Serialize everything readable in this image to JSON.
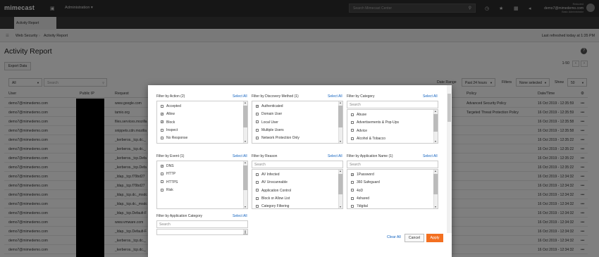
{
  "topbar": {
    "logo": "mimecast",
    "menu": "Administration ▾",
    "search_placeholder": "Search Mimecast Center",
    "user_label": "Reducted",
    "user_email": "demo7@mimedemo.com",
    "user_role": "Basic Administrator"
  },
  "tab": {
    "label": "Activity Report"
  },
  "breadcrumb": {
    "items": [
      "Web Security",
      "Activity Report"
    ],
    "refresh": "Last refreshed today at 1:35 PM"
  },
  "page": {
    "title": "Activity Report",
    "pagination": "1-50"
  },
  "toolbar": {
    "export": "Export Data",
    "scope": "All",
    "search_placeholder": "Search",
    "date_range_label": "Date Range",
    "date_range": "Past 24 hours",
    "filters_label": "Filters",
    "filters_value": "None selected",
    "show_label": "Show",
    "show_value": "50"
  },
  "table": {
    "columns": [
      "User",
      "Public IP",
      "Request",
      "Policy",
      "Date/Time"
    ],
    "rows": [
      {
        "user": "demo7@mimedemo.com",
        "request": "www.google.com",
        "policy": "Advanced Security Policy",
        "time": "16 Oct 2019 - 12:35:59"
      },
      {
        "user": "demo7@mimedemo.com",
        "request": "tamio.org",
        "policy": "Targeted Threat Protection Policy",
        "time": "16 Oct 2019 - 12:35:59"
      },
      {
        "user": "demo7@mimedemo.com",
        "request": "files.services.mozilla",
        "policy": "",
        "time": "16 Oct 2019 - 12:35:58"
      },
      {
        "user": "demo7@mimedemo.com",
        "request": "snippets.cdn.mozilla",
        "policy": "",
        "time": "16 Oct 2019 - 12:35:58"
      },
      {
        "user": "demo7@mimedemo.com",
        "request": "_kerberos._tcp.dc._",
        "policy": "",
        "time": "16 Oct 2019 - 12:35:22"
      },
      {
        "user": "demo7@mimedemo.com",
        "request": "_kerberos._tcp.dc._",
        "policy": "",
        "time": "16 Oct 2019 - 12:35:22"
      },
      {
        "user": "demo7@mimedemo.com",
        "request": "_kerberos._tcp.Defa",
        "policy": "",
        "time": "16 Oct 2019 - 12:35:22"
      },
      {
        "user": "demo7@mimedemo.com",
        "request": "_kerberos._tcp.Defa",
        "policy": "",
        "time": "16 Oct 2019 - 12:35:22"
      },
      {
        "user": "demo7@mimedemo.com",
        "request": "_ldap._tcp.f79bd27",
        "policy": "",
        "time": "16 Oct 2019 - 12:34:32"
      },
      {
        "user": "demo7@mimedemo.com",
        "request": "_ldap._tcp.f79bd27",
        "policy": "",
        "time": "16 Oct 2019 - 12:34:32"
      },
      {
        "user": "demo7@mimedemo.com",
        "request": "_ldap._tcp.dc._msdc",
        "policy": "",
        "time": "16 Oct 2019 - 12:34:32"
      },
      {
        "user": "demo7@mimedemo.com",
        "request": "_ldap._tcp.dc._msdc",
        "policy": "",
        "time": "16 Oct 2019 - 12:34:32"
      },
      {
        "user": "demo7@mimedemo.com",
        "request": "_ldap._tcp.Default-F",
        "policy": "",
        "time": "16 Oct 2019 - 12:34:32"
      },
      {
        "user": "demo7@mimedemo.com",
        "request": "www.vmware.com",
        "policy": "",
        "time": "16 Oct 2019 - 12:34:32"
      },
      {
        "user": "demo7@mimedemo.com",
        "request": "_ldap._tcp.Default-F",
        "policy": "",
        "time": "16 Oct 2019 - 12:34:32"
      },
      {
        "user": "demo7@mimedemo.com",
        "request": "_kerberos._tcp.dc._",
        "policy": "",
        "time": "16 Oct 2019 - 12:34:32"
      },
      {
        "user": "demo7@mimedemo.com",
        "request": "_kerberos._tcp.dc._",
        "policy": "",
        "time": "16 Oct 2019 - 12:34:32"
      }
    ]
  },
  "modal": {
    "select_all": "Select All",
    "groups": [
      {
        "title": "Filter by Action (2)",
        "items": [
          {
            "l": "Accepted",
            "c": false
          },
          {
            "l": "Allow",
            "c": true
          },
          {
            "l": "Block",
            "c": true
          },
          {
            "l": "Inspect",
            "c": false
          },
          {
            "l": "No Response",
            "c": false
          },
          {
            "l": "Unfiltered",
            "c": false
          }
        ]
      },
      {
        "title": "Filter by Discovery Method (1)",
        "items": [
          {
            "l": "Authenticated",
            "c": true
          },
          {
            "l": "Domain User",
            "c": false
          },
          {
            "l": "Local User",
            "c": false
          },
          {
            "l": "Multiple Users",
            "c": false
          },
          {
            "l": "Network Protection Only",
            "c": false
          },
          {
            "l": "No Logged In User",
            "c": false
          }
        ]
      },
      {
        "title": "Filter by Category",
        "search": "Search",
        "items": [
          {
            "l": "Abuse",
            "c": false
          },
          {
            "l": "Advertisements & Pop-Ups",
            "c": false
          },
          {
            "l": "Advice",
            "c": false
          },
          {
            "l": "Alcohol & Tobacco",
            "c": false
          },
          {
            "l": "Anonymizers",
            "c": false
          }
        ]
      },
      {
        "title": "Filter by Event (1)",
        "items": [
          {
            "l": "DNS",
            "c": true
          },
          {
            "l": "HTTP",
            "c": false
          },
          {
            "l": "HTTPS",
            "c": false
          },
          {
            "l": "Risk",
            "c": false
          }
        ]
      },
      {
        "title": "Filter by Reason",
        "search": "Search",
        "items": [
          {
            "l": "AV Infected",
            "c": false
          },
          {
            "l": "AV Unscannable",
            "c": false
          },
          {
            "l": "Application Control",
            "c": false
          },
          {
            "l": "Block or Allow List",
            "c": false
          },
          {
            "l": "Category Filtering",
            "c": false
          }
        ]
      },
      {
        "title": "Filter by Application Name (1)",
        "search": "Search",
        "items": [
          {
            "l": "1Password",
            "c": true
          },
          {
            "l": "360 Safeguard",
            "c": false
          },
          {
            "l": "4oD",
            "c": false
          },
          {
            "l": "4shared",
            "c": false
          },
          {
            "l": "7digital",
            "c": false
          }
        ]
      },
      {
        "title": "Filter by Application Category",
        "search": "Search",
        "items": []
      }
    ],
    "clear_all": "Clear All",
    "cancel": "Cancel",
    "apply": "Apply"
  },
  "colors": {
    "accent": "#f37021",
    "link": "#1565c0",
    "topbar": "#2d2d2d"
  }
}
